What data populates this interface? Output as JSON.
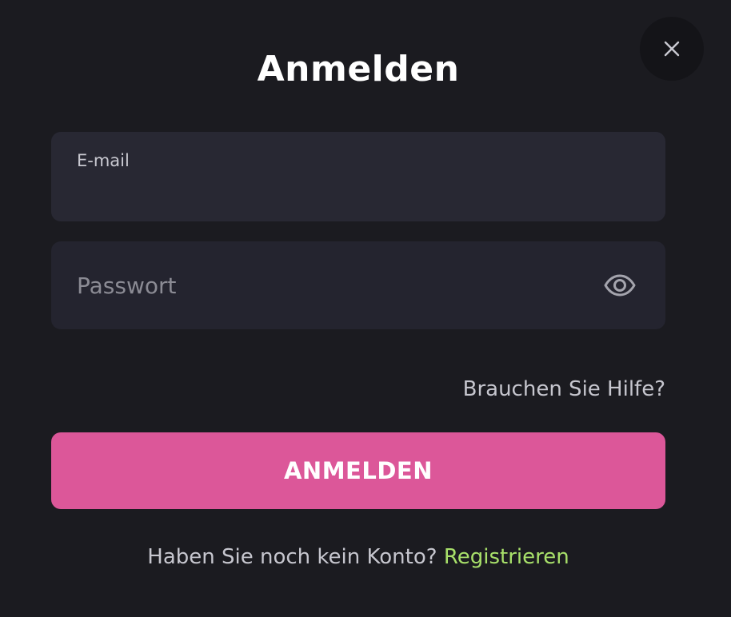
{
  "modal": {
    "title": "Anmelden",
    "close_icon": "close-icon"
  },
  "form": {
    "email": {
      "label": "E-mail",
      "value": ""
    },
    "password": {
      "placeholder": "Passwort",
      "value": "",
      "toggle_icon": "eye-icon"
    },
    "help_link": "Brauchen Sie Hilfe?",
    "submit_label": "ANMELDEN"
  },
  "footer": {
    "prompt": "Haben Sie noch kein Konto? ",
    "register_link": "Registrieren"
  },
  "colors": {
    "background": "#1b1b20",
    "field_background": "#282833",
    "primary_button": "#dc5799",
    "link_accent": "#a8e06a"
  }
}
